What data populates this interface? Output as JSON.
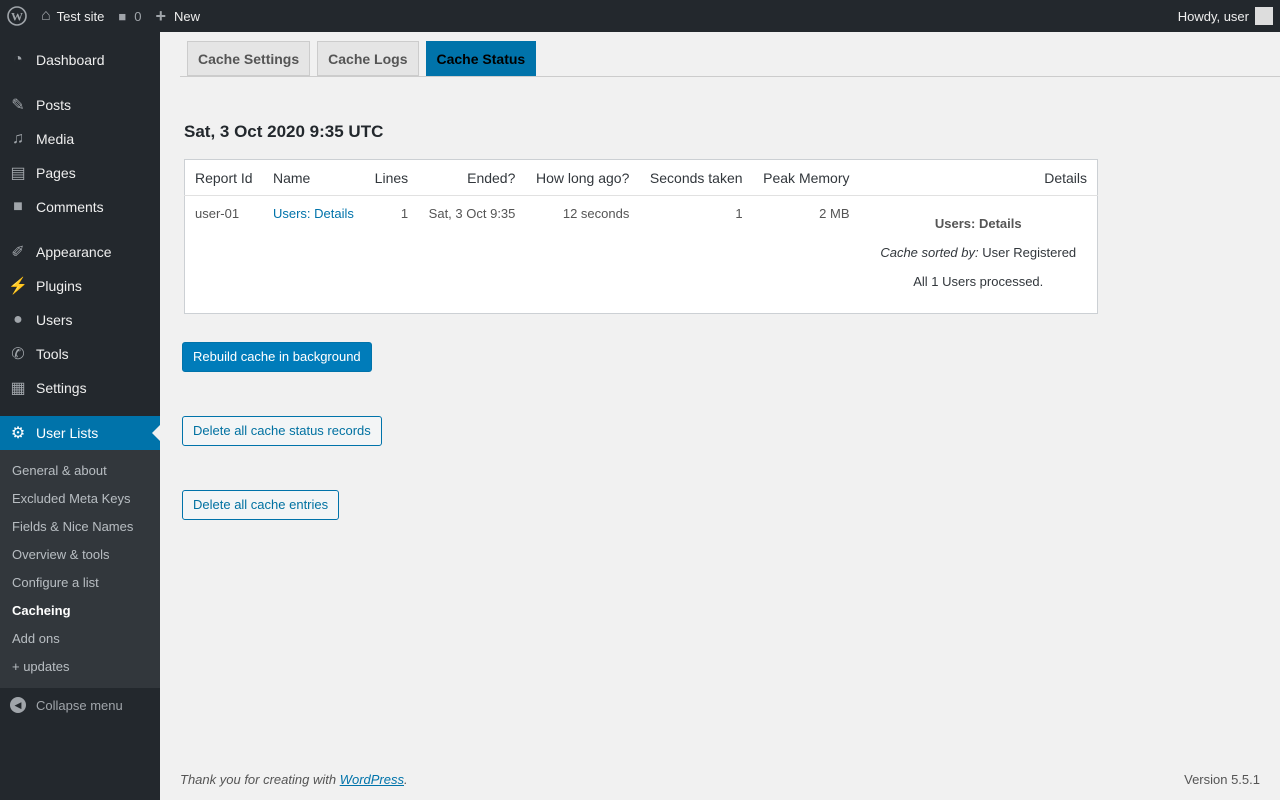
{
  "adminbar": {
    "site": "Test site",
    "comments": "0",
    "new": "New",
    "howdy": "Howdy, user"
  },
  "sidebar": {
    "items": [
      "Dashboard",
      "Posts",
      "Media",
      "Pages",
      "Comments",
      "Appearance",
      "Plugins",
      "Users",
      "Tools",
      "Settings",
      "User Lists"
    ],
    "submenu": [
      "General & about",
      "Excluded Meta Keys",
      "Fields & Nice Names",
      "Overview & tools",
      "Configure a list",
      "Cacheing",
      "Add ons",
      "+ updates"
    ],
    "collapse": "Collapse menu"
  },
  "tabs": [
    "Cache Settings",
    "Cache Logs",
    "Cache Status"
  ],
  "heading": "Sat, 3 Oct 2020 9:35 UTC",
  "table": {
    "headers": [
      "Report Id",
      "Name",
      "Lines",
      "Ended?",
      "How long ago?",
      "Seconds taken",
      "Peak Memory",
      "Details"
    ],
    "row": {
      "report_id": "user-01",
      "name": "Users: Details",
      "lines": "1",
      "ended": "Sat, 3 Oct 9:35",
      "ago": "12 seconds",
      "seconds": "1",
      "memory": "2 MB",
      "details_title": "Users: Details",
      "sorted_label": "Cache sorted by:",
      "sorted_value": " User Registered",
      "processed": "All 1 Users processed."
    }
  },
  "buttons": {
    "rebuild": "Rebuild cache in background",
    "delete_status": "Delete all cache status records",
    "delete_entries": "Delete all cache entries"
  },
  "footer": {
    "thanks": "Thank you for creating with ",
    "link": "WordPress",
    "period": ".",
    "version": "Version 5.5.1"
  }
}
